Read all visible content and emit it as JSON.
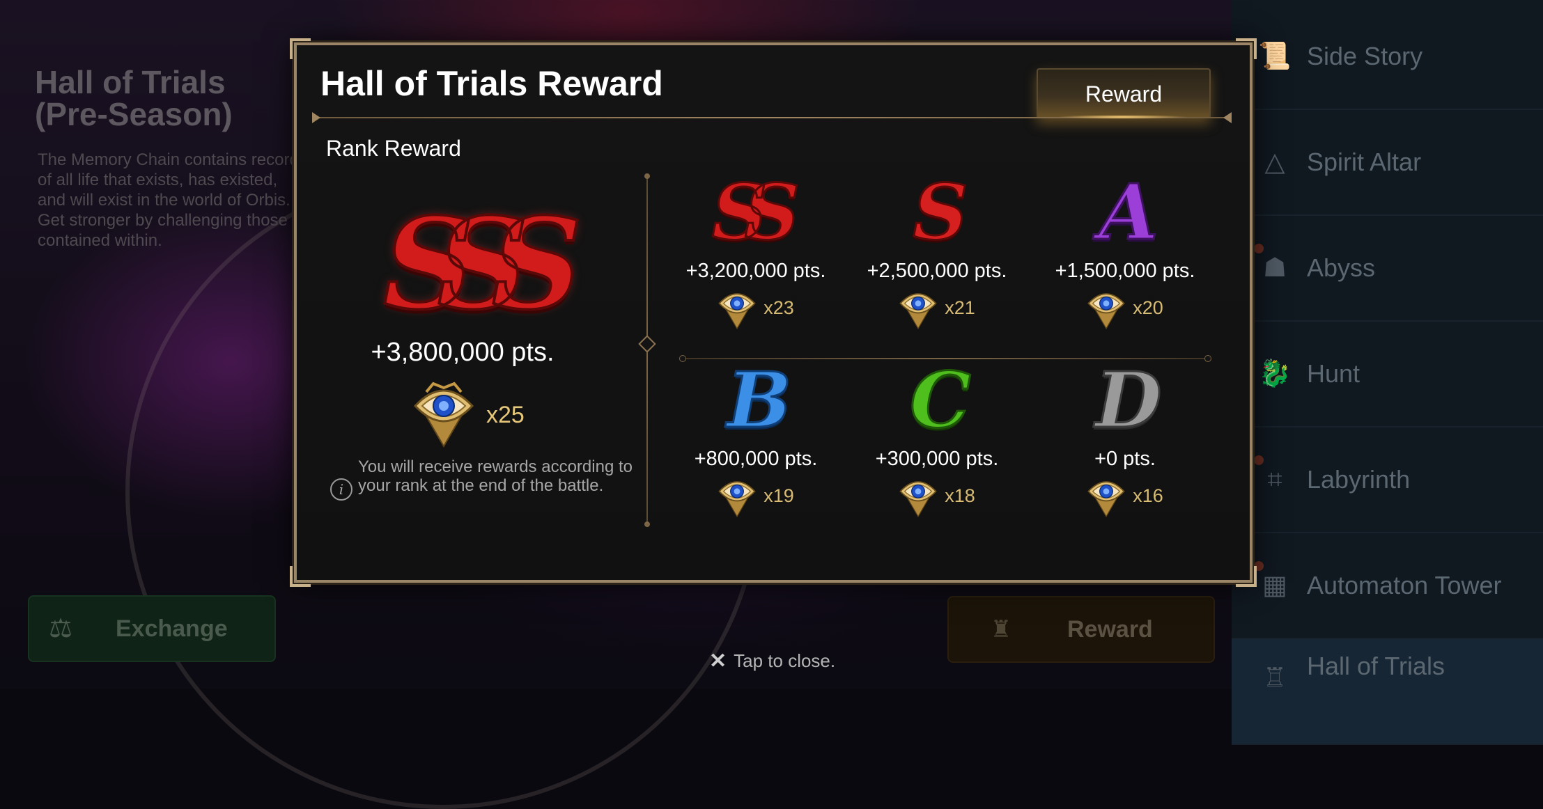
{
  "background": {
    "title": "Hall of Trials\n(Pre-Season)",
    "title_line1": "Hall of Trials",
    "title_line2": "(Pre-Season)",
    "description": "The Memory Chain contains records of all life that exists, has existed, and will exist in the world of Orbis. Get stronger by challenging those contained within.",
    "exchange_label": "Exchange",
    "reward_label": "Reward"
  },
  "nav": {
    "items": [
      {
        "label": "Side Story",
        "icon": "scroll-icon"
      },
      {
        "label": "Spirit Altar",
        "icon": "triangle-icon"
      },
      {
        "label": "Abyss",
        "icon": "beast-icon"
      },
      {
        "label": "Hunt",
        "icon": "dragon-icon"
      },
      {
        "label": "Labyrinth",
        "icon": "maze-icon"
      },
      {
        "label": "Automaton Tower",
        "icon": "tower-icon"
      },
      {
        "label": "Hall of Trials",
        "icon": "hall-icon"
      }
    ]
  },
  "modal": {
    "title": "Hall of Trials Reward",
    "tab_label": "Reward",
    "section_label": "Rank Reward",
    "top_rank": {
      "grade": "SSS",
      "points": "+3,800,000 pts.",
      "quantity": "x25"
    },
    "info_text": "You will receive rewards according to your rank at the end of the battle.",
    "ranks": [
      {
        "grade": "SS",
        "points": "+3,200,000 pts.",
        "quantity": "x23"
      },
      {
        "grade": "S",
        "points": "+2,500,000 pts.",
        "quantity": "x21"
      },
      {
        "grade": "A",
        "points": "+1,500,000 pts.",
        "quantity": "x20"
      },
      {
        "grade": "B",
        "points": "+800,000 pts.",
        "quantity": "x19"
      },
      {
        "grade": "C",
        "points": "+300,000 pts.",
        "quantity": "x18"
      },
      {
        "grade": "D",
        "points": "+0 pts.",
        "quantity": "x16"
      }
    ]
  },
  "footer": {
    "close_hint": "Tap to close."
  },
  "colors": {
    "frame_gold": "#9a8666",
    "reward_qty": "#d8bc74"
  }
}
